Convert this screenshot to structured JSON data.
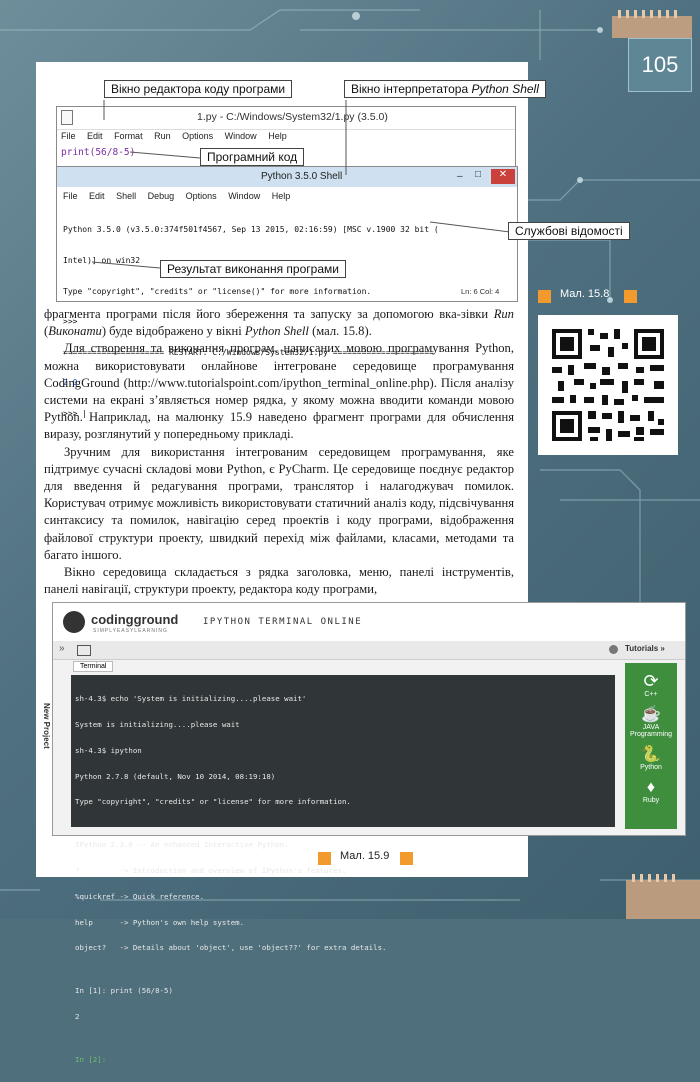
{
  "page_number": "105",
  "fig1": {
    "editor_title": "1.py - C:/Windows/System32/1.py (3.5.0)",
    "editor_menu": [
      "File",
      "Edit",
      "Format",
      "Run",
      "Options",
      "Window",
      "Help"
    ],
    "editor_code": "print(56/8-5)",
    "shell_title": "Python 3.5.0 Shell",
    "shell_menu": [
      "File",
      "Edit",
      "Shell",
      "Debug",
      "Options",
      "Window",
      "Help"
    ],
    "shell_lines": [
      "Python 3.5.0 (v3.5.0:374f501f4567, Sep 13 2015, 02:16:59) [MSC v.1900 32 bit (",
      "Intel)] on win32",
      "Type \"copyright\", \"credits\" or \"license()\" for more information.",
      ">>> ",
      "===================== RESTART: C:/Windows/System32/1.py =====================",
      "2.0",
      ">>> |"
    ],
    "status": "Ln: 6 Col: 4",
    "callouts": {
      "editor_window": "Вікно редактора коду програми",
      "interpreter_window_prefix": "Вікно інтерпретатора ",
      "interpreter_window_name": "Python Shell",
      "program_code": "Програмний код",
      "service_info": "Службові відомості",
      "result": "Результат виконання програми"
    },
    "caption": "Мал. 15.8"
  },
  "paragraphs": {
    "p1a": "фрагмента програми після його збереження та запуску за допомогою вка-",
    "p1b_pre": "зівки ",
    "p1b_run": "Run",
    "p1b_mid1": " (",
    "p1b_exec": "Виконати",
    "p1b_mid2": ") буде відображено у вікні ",
    "p1b_shell": "Python Shell",
    "p1b_end": " (мал. 15.8).",
    "p2": "Для створення та виконання програм, написаних мовою програмування Python, можна використовувати онлайнове інтегроване середовище програмування CodingGround (http://www.tutorialspoint.com/ipython_terminal_online.php). Після аналізу системи на екрані з’являється номер рядка, у якому можна вводити команди мовою Python. Наприклад, на малюнку 15.9 наведено фрагмент програми для обчислення виразу, розглянутий у попередньому прикладі.",
    "p3": "Зручним для використання інтегрованим середовищем програмування, яке підтримує сучасні складові мови Python, є PyCharm. Це середовище поєднує редактор для введення й редагування програми, транслятор і налагоджувач помилок. Користувач отримує можливість використовувати статичний аналіз коду, підсвічування синтаксису та помилок, навігацію серед проектів і коду програми, відображення файлової структури проекту, швидкий перехід між файлами, класами, методами та багато іншого.",
    "p4": "Вікно середовища складається з рядка заголовка, меню, панелі інструментів, панелі навігації, структури проекту, редактора коду програми,"
  },
  "fig2": {
    "logo": "codingground",
    "logo_sub": "SIMPLYEASYLEARNING",
    "header_title": "IPYTHON TERMINAL ONLINE",
    "side_tab": "New Project",
    "tab_label": "Terminal",
    "tutorials": "Tutorials",
    "terminal_lines": [
      "sh-4.3$ echo 'System is initializing....please wait'",
      "System is initializing....please wait",
      "sh-4.3$ ipython",
      "Python 2.7.8 (default, Nov 10 2014, 08:19:18)",
      "Type \"copyright\", \"credits\" or \"license\" for more information.",
      "",
      "IPython 2.3.0 -- An enhanced Interactive Python.",
      "?         -> Introduction and overview of IPython's features.",
      "%quickref -> Quick reference.",
      "help      -> Python's own help system.",
      "object?   -> Details about 'object', use 'object??' for extra details.",
      "",
      "In [1]: print (56/8-5)",
      "2",
      "",
      "In [2]:"
    ],
    "languages": [
      "C++",
      "JAVA Programming",
      "Python",
      "Ruby"
    ],
    "caption": "Мал. 15.9"
  },
  "colors": {
    "accent": "#f29a2e",
    "terminal_bg": "#303638",
    "page_bg": "#4f7080"
  }
}
